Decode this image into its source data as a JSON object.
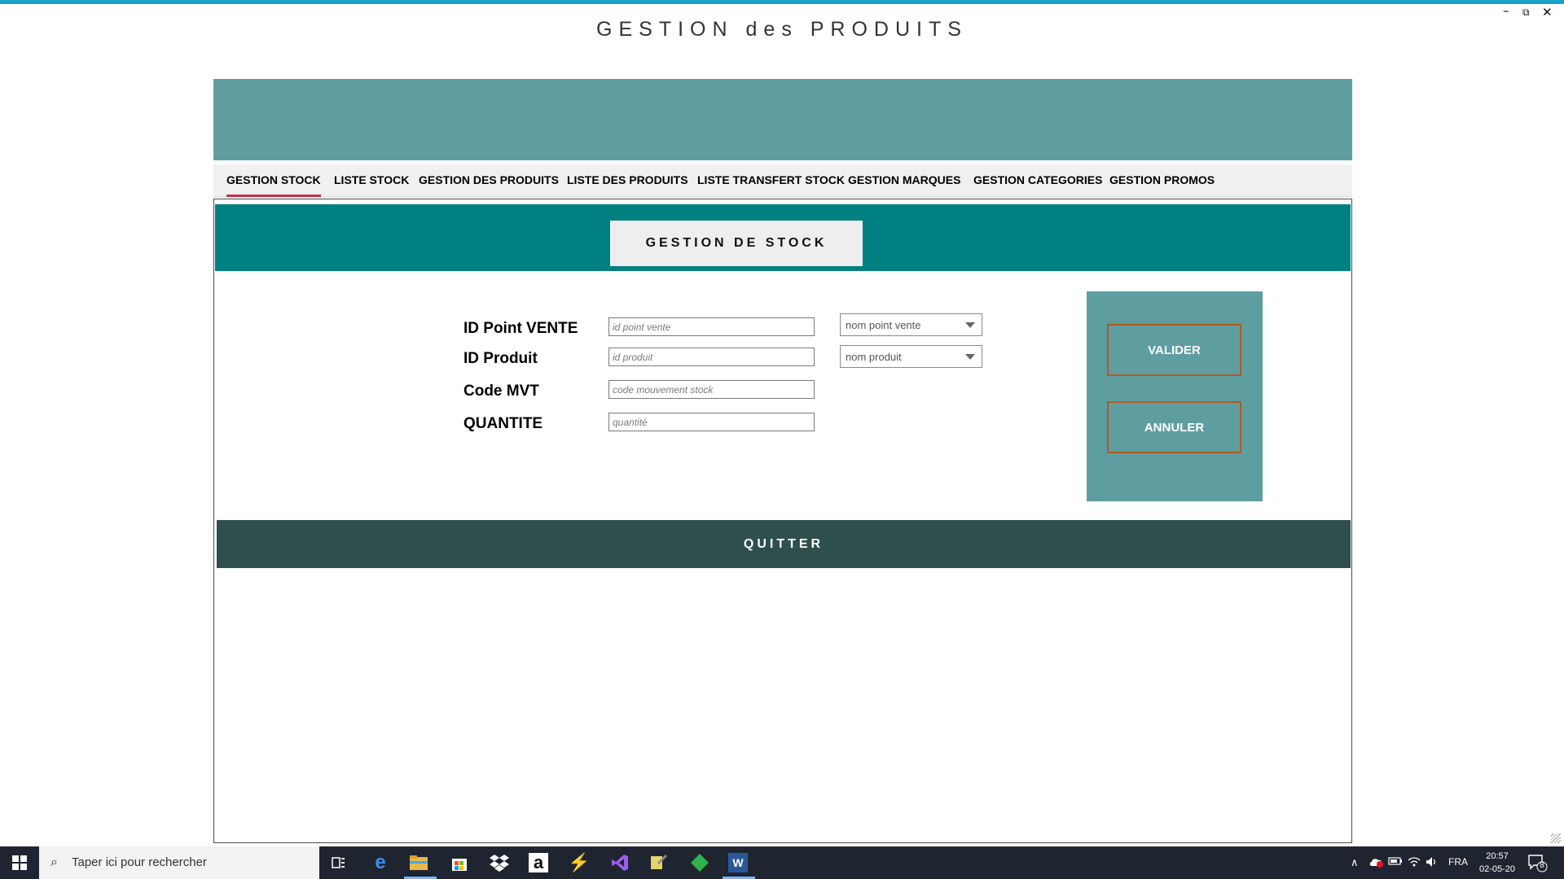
{
  "window": {
    "title": "GESTION des PRODUITS",
    "controls": {
      "minimize": "–",
      "restore": "⧉",
      "close": "✕"
    }
  },
  "tabs": [
    {
      "label": "GESTION STOCK",
      "active": true
    },
    {
      "label": "LISTE STOCK"
    },
    {
      "label": "GESTION DES PRODUITS"
    },
    {
      "label": "LISTE DES PRODUITS"
    },
    {
      "label": "LISTE TRANSFERT STOCK"
    },
    {
      "label": "GESTION MARQUES"
    },
    {
      "label": "GESTION CATEGORIES"
    },
    {
      "label": "GESTION PROMOS"
    }
  ],
  "section": {
    "title": "GESTION DE STOCK"
  },
  "form": {
    "point_vente": {
      "label": "ID Point VENTE",
      "placeholder": "id point vente",
      "combo": "nom point vente"
    },
    "produit": {
      "label": "ID Produit",
      "placeholder": "id produit",
      "combo": "nom produit"
    },
    "code_mvt": {
      "label": "Code MVT",
      "placeholder": "code mouvement stock"
    },
    "quantite": {
      "label": "QUANTITE",
      "placeholder": "quantité"
    }
  },
  "actions": {
    "valider": "VALIDER",
    "annuler": "ANNULER"
  },
  "quit": "QUITTER",
  "taskbar": {
    "search_placeholder": "Taper ici pour rechercher",
    "language": "FRA",
    "time": "20:57",
    "date": "02-05-20",
    "notification_count": "8"
  },
  "colors": {
    "accent_top": "#1aa3c8",
    "banner": "#5f9ea0",
    "section_header": "#008080",
    "quit_bar": "#2f4f4f",
    "button_border": "#b35a1f",
    "tab_underline": "#c4314b"
  }
}
